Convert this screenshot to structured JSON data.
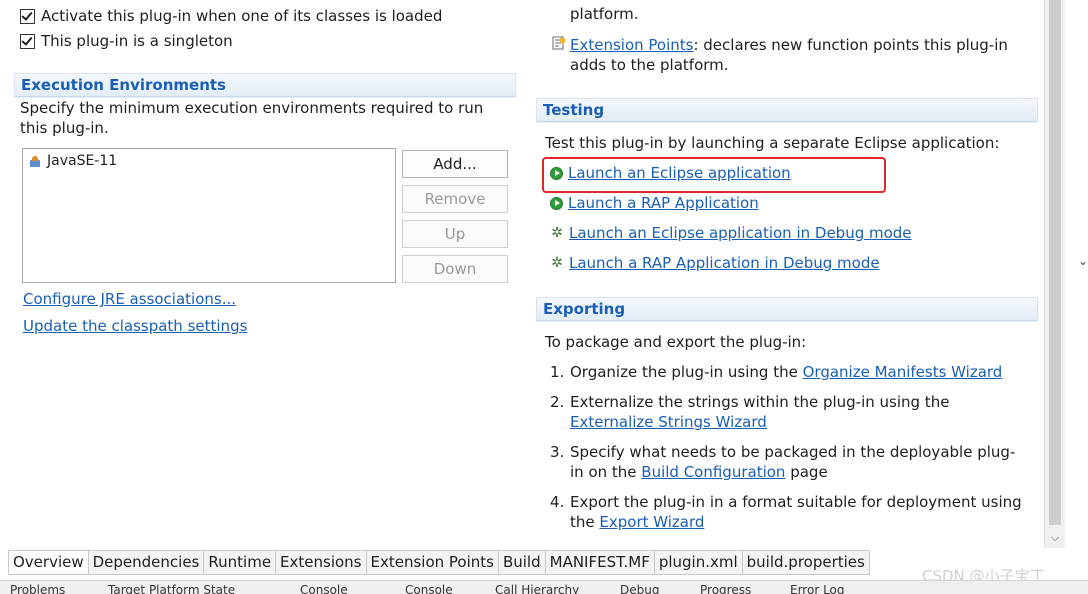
{
  "general": {
    "checkbox_activate": "Activate this plug-in when one of its classes is loaded",
    "checkbox_singleton": "This plug-in is a singleton"
  },
  "exec_env": {
    "header": "Execution Environments",
    "description": "Specify the minimum execution environments required to run this plug-in.",
    "list_items": [
      "JavaSE-11"
    ],
    "buttons": {
      "add": "Add...",
      "remove": "Remove",
      "up": "Up",
      "down": "Down"
    },
    "link_configure": "Configure JRE associations...",
    "link_update": "Update the classpath settings"
  },
  "extensions": {
    "partial_text": "platform.",
    "ext_points_link": "Extension Points",
    "ext_points_text": ": declares new function points this plug-in adds to the platform."
  },
  "testing": {
    "header": "Testing",
    "description": "Test this plug-in by launching a separate Eclipse application:",
    "links": [
      "Launch an Eclipse application",
      "Launch a RAP Application",
      "Launch an Eclipse application in Debug mode",
      "Launch a RAP Application in Debug mode"
    ]
  },
  "exporting": {
    "header": "Exporting",
    "description": "To package and export the plug-in:",
    "steps": [
      {
        "num": "1.",
        "pre": "Organize the plug-in using the ",
        "link": "Organize Manifests Wizard",
        "post": ""
      },
      {
        "num": "2.",
        "pre": "Externalize the strings within the plug-in using the ",
        "link": "Externalize Strings Wizard",
        "post": ""
      },
      {
        "num": "3.",
        "pre": "Specify what needs to be packaged in the deployable plug-in on the ",
        "link": "Build Configuration",
        "post": " page"
      },
      {
        "num": "4.",
        "pre": "Export the plug-in in a format suitable for deployment using the ",
        "link": "Export Wizard",
        "post": ""
      }
    ]
  },
  "tabs": [
    "Overview",
    "Dependencies",
    "Runtime",
    "Extensions",
    "Extension Points",
    "Build",
    "MANIFEST.MF",
    "plugin.xml",
    "build.properties"
  ],
  "bottom_views": [
    "Problems",
    "Target Platform State",
    "Console",
    "Console",
    "Call Hierarchy",
    "Debug",
    "Progress",
    "Error Log"
  ],
  "watermark": "CSDN @小子宝丁",
  "colors": {
    "link": "#1a5fb4",
    "section_header": "#1a5fb4",
    "highlight_box": "#e0262a"
  }
}
